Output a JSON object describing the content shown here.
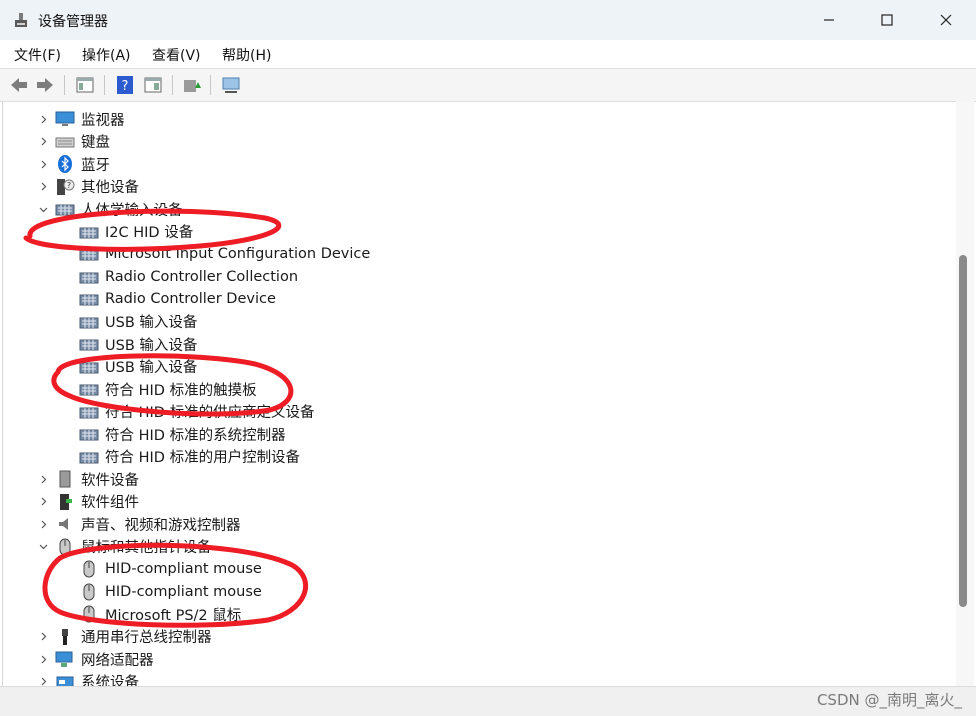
{
  "window": {
    "title": "设备管理器",
    "controls": [
      "minimize-icon",
      "maximize-icon",
      "close-icon"
    ]
  },
  "menu": [
    "文件(F)",
    "操作(A)",
    "查看(V)",
    "帮助(H)"
  ],
  "toolbar": [
    "back-icon",
    "forward-icon",
    "properties-icon",
    "help-icon",
    "details-pane-icon",
    "update-driver-icon",
    "scan-hardware-icon"
  ],
  "tree": [
    {
      "label": "监视器",
      "icon": "monitor-icon",
      "level": 0,
      "expanded": false
    },
    {
      "label": "键盘",
      "icon": "keyboard-icon",
      "level": 0,
      "expanded": false
    },
    {
      "label": "蓝牙",
      "icon": "bluetooth-icon",
      "level": 0,
      "expanded": false
    },
    {
      "label": "其他设备",
      "icon": "other-device-icon",
      "level": 0,
      "expanded": false
    },
    {
      "label": "人体学输入设备",
      "icon": "hid-icon",
      "level": 0,
      "expanded": true
    },
    {
      "label": "I2C HID 设备",
      "icon": "hid-icon",
      "level": 1
    },
    {
      "label": "Microsoft Input Configuration Device",
      "icon": "hid-icon",
      "level": 1
    },
    {
      "label": "Radio Controller Collection",
      "icon": "hid-icon",
      "level": 1
    },
    {
      "label": "Radio Controller Device",
      "icon": "hid-icon",
      "level": 1
    },
    {
      "label": "USB 输入设备",
      "icon": "hid-icon",
      "level": 1
    },
    {
      "label": "USB 输入设备",
      "icon": "hid-icon",
      "level": 1
    },
    {
      "label": "USB 输入设备",
      "icon": "hid-icon",
      "level": 1
    },
    {
      "label": "符合 HID 标准的触摸板",
      "icon": "hid-icon",
      "level": 1
    },
    {
      "label": "符合 HID 标准的供应商定义设备",
      "icon": "hid-icon",
      "level": 1
    },
    {
      "label": "符合 HID 标准的系统控制器",
      "icon": "hid-icon",
      "level": 1
    },
    {
      "label": "符合 HID 标准的用户控制设备",
      "icon": "hid-icon",
      "level": 1
    },
    {
      "label": "软件设备",
      "icon": "software-device-icon",
      "level": 0,
      "expanded": false
    },
    {
      "label": "软件组件",
      "icon": "software-component-icon",
      "level": 0,
      "expanded": false
    },
    {
      "label": "声音、视频和游戏控制器",
      "icon": "speaker-icon",
      "level": 0,
      "expanded": false
    },
    {
      "label": "鼠标和其他指针设备",
      "icon": "mouse-icon",
      "level": 0,
      "expanded": true
    },
    {
      "label": "HID-compliant mouse",
      "icon": "mouse-icon",
      "level": 1
    },
    {
      "label": "HID-compliant mouse",
      "icon": "mouse-icon",
      "level": 1
    },
    {
      "label": "Microsoft PS/2 鼠标",
      "icon": "mouse-icon",
      "level": 1
    },
    {
      "label": "通用串行总线控制器",
      "icon": "usb-icon",
      "level": 0,
      "expanded": false
    },
    {
      "label": "网络适配器",
      "icon": "network-icon",
      "level": 0,
      "expanded": false
    },
    {
      "label": "系统设备",
      "icon": "system-device-icon",
      "level": 0,
      "expanded": false
    }
  ],
  "watermark": "CSDN @_南明_离火_",
  "colors": {
    "annotation": "#ee1c24",
    "titlebar": "#eef3f7",
    "scroll_thumb": "#8a8a8a"
  }
}
